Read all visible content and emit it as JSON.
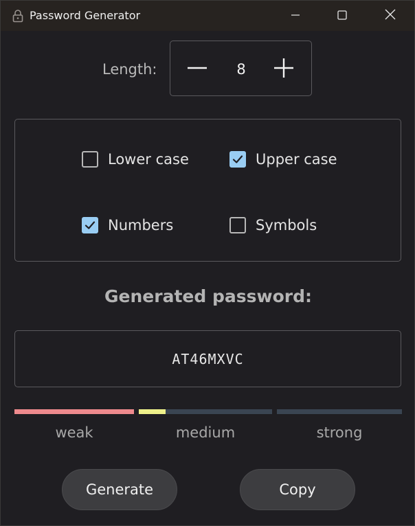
{
  "window": {
    "title": "Password Generator",
    "icon": "lock-icon"
  },
  "caption_buttons": {
    "minimize_icon": "minimize-icon",
    "maximize_icon": "maximize-icon",
    "close_icon": "close-icon"
  },
  "length": {
    "label": "Length:",
    "value": "8",
    "decrement_icon": "minus-icon",
    "increment_icon": "plus-icon"
  },
  "options": {
    "lower_case": {
      "label": "Lower case",
      "checked": false
    },
    "upper_case": {
      "label": "Upper case",
      "checked": true
    },
    "numbers": {
      "label": "Numbers",
      "checked": true
    },
    "symbols": {
      "label": "Symbols",
      "checked": false
    }
  },
  "output": {
    "title": "Generated password:",
    "password": "AT46MXVC"
  },
  "strength": {
    "levels": [
      {
        "label": "weak",
        "fill_fraction": 1.0,
        "color": "#ee8a8d"
      },
      {
        "label": "medium",
        "fill_fraction": 0.2,
        "color": "#eef08a"
      },
      {
        "label": "strong",
        "fill_fraction": 0.0,
        "color": "#3a4552"
      }
    ],
    "track_color": "#3a4552"
  },
  "actions": {
    "generate_label": "Generate",
    "copy_label": "Copy"
  },
  "colors": {
    "accent": "#99cdf3",
    "background": "#1f1e22",
    "titlebar": "#272320"
  }
}
